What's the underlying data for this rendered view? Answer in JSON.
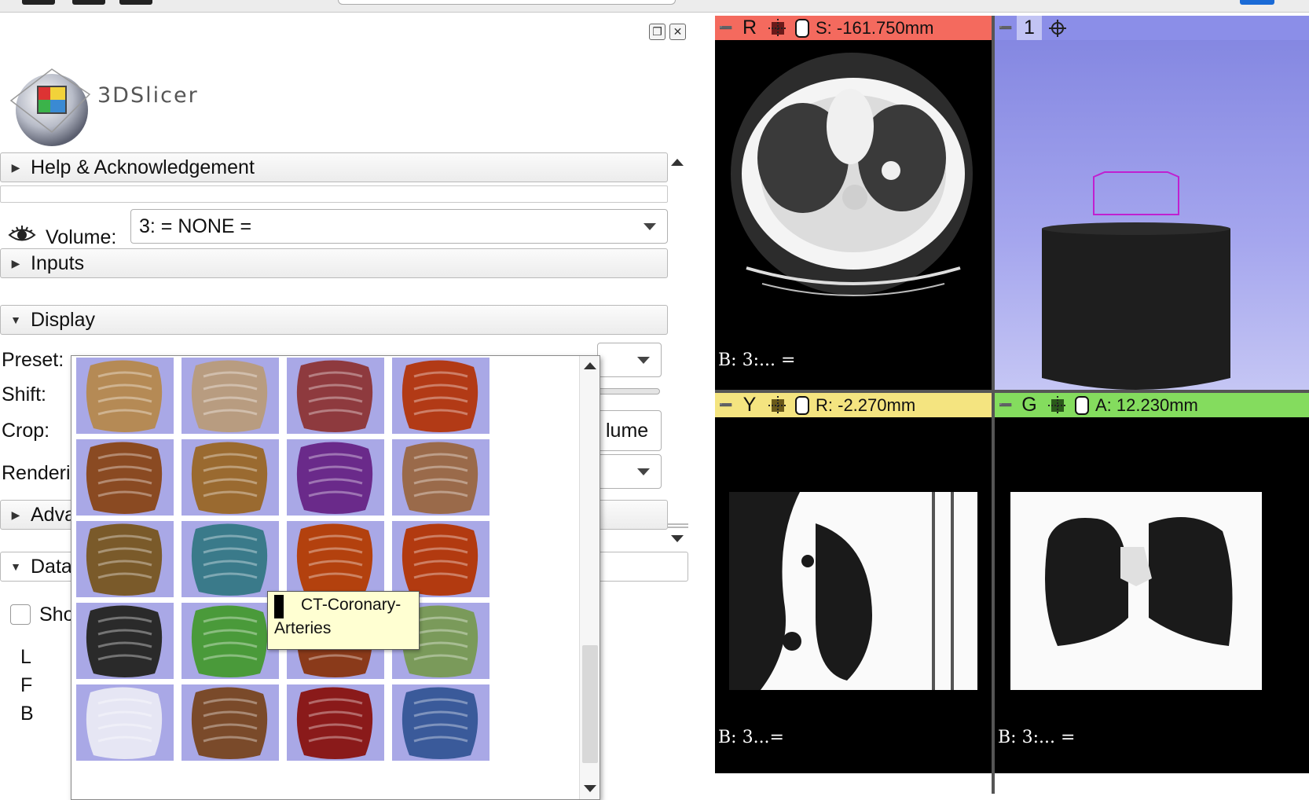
{
  "app": {
    "logo_text": "3DSlicer"
  },
  "sections": {
    "help": "Help & Acknowledgement",
    "inputs": "Inputs",
    "display": "Display",
    "advanced": "Adva",
    "data": "Data"
  },
  "volume": {
    "label": "Volume:",
    "value": "3: = NONE ="
  },
  "form": {
    "preset": "Preset:",
    "shift": "Shift:",
    "crop": "Crop:",
    "rendering": "Renderi",
    "crop_button_fragment": "lume"
  },
  "data_section": {
    "show_fragment": "Sho",
    "letters": [
      "L",
      "F",
      "B"
    ]
  },
  "preset_tooltip": {
    "line1": "CT-Coronary-",
    "line2": "Arteries"
  },
  "presets": [
    {
      "name": "preset-ct-aaa",
      "color": "#b58a55"
    },
    {
      "name": "preset-ct-aaa2",
      "color": "#b89c80"
    },
    {
      "name": "preset-ct-bone",
      "color": "#8e3a3e"
    },
    {
      "name": "preset-ct-bones",
      "color": "#b23a16"
    },
    {
      "name": "preset-ct-cardiac",
      "color": "#8a4a22"
    },
    {
      "name": "preset-ct-cardiac2",
      "color": "#9a6a30"
    },
    {
      "name": "preset-ct-cardiac3",
      "color": "#6a2a8a"
    },
    {
      "name": "preset-ct-chest-contrast",
      "color": "#9a6a4a"
    },
    {
      "name": "preset-ct-chest-vessels",
      "color": "#7a5a2a"
    },
    {
      "name": "preset-ct-coronary-arteries",
      "color": "#3a7a8a"
    },
    {
      "name": "preset-ct-coronary-arteries-2",
      "color": "#b3410e"
    },
    {
      "name": "preset-ct-coronary-arteries-3",
      "color": "#b23a10"
    },
    {
      "name": "preset-ct-cropped-volume-bone",
      "color": "#2a2a2a"
    },
    {
      "name": "preset-ct-fat",
      "color": "#4a9a3a"
    },
    {
      "name": "preset-ct-liver-vasculature",
      "color": "#8a3a1a"
    },
    {
      "name": "preset-ct-lung",
      "color": "#7a9a5a"
    },
    {
      "name": "preset-ct-mip",
      "color": "#e6e6f4"
    },
    {
      "name": "preset-ct-muscle",
      "color": "#7a4a2a"
    },
    {
      "name": "preset-ct-pulmonary-arteries",
      "color": "#8a1a1a"
    },
    {
      "name": "preset-ct-soft-tissue",
      "color": "#3a5a9a"
    }
  ],
  "views": {
    "red": {
      "letter": "R",
      "coord": "S: -161.750mm",
      "footer": "B: 3:... =",
      "color": "#f46a5e"
    },
    "threed": {
      "letter": "1",
      "color": "#8b8ee8"
    },
    "yellow": {
      "letter": "Y",
      "coord": "R: -2.270mm",
      "footer": "B: 3...=",
      "color": "#f4e480"
    },
    "green": {
      "letter": "G",
      "coord": "A: 12.230mm",
      "footer": "B: 3:... =",
      "color": "#84dc5e"
    }
  }
}
